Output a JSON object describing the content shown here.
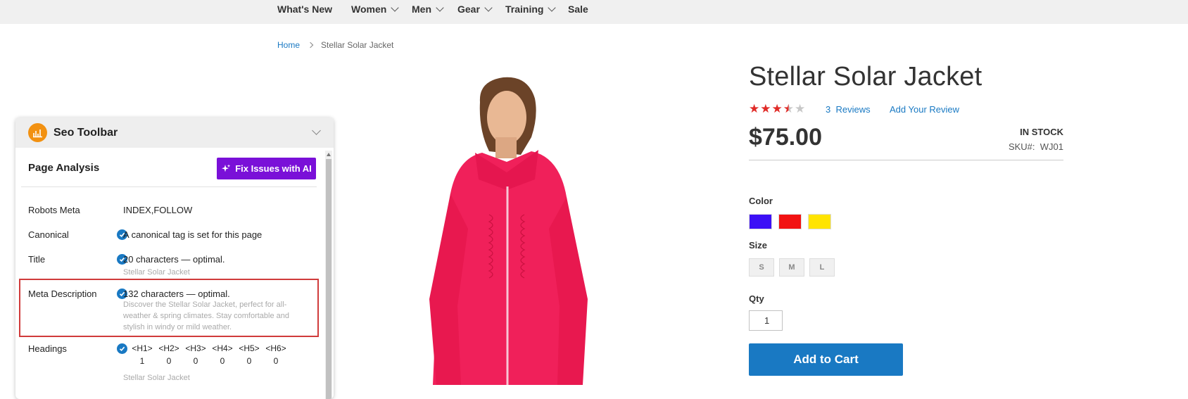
{
  "nav": {
    "items": [
      {
        "label": "What's New",
        "dropdown": false
      },
      {
        "label": "Women",
        "dropdown": true
      },
      {
        "label": "Men",
        "dropdown": true
      },
      {
        "label": "Gear",
        "dropdown": true
      },
      {
        "label": "Training",
        "dropdown": true
      },
      {
        "label": "Sale",
        "dropdown": false
      }
    ]
  },
  "breadcrumb": {
    "home": "Home",
    "current": "Stellar Solar Jacket"
  },
  "product": {
    "title": "Stellar Solar Jacket",
    "rating_stars": 3.5,
    "reviews_count": "3",
    "reviews_label": "Reviews",
    "add_review": "Add Your Review",
    "price": "$75.00",
    "stock": "IN STOCK",
    "sku_label": "SKU#:",
    "sku": "WJ01",
    "color_label": "Color",
    "colors": [
      "#3c10f6",
      "#f21212",
      "#ffe401"
    ],
    "size_label": "Size",
    "sizes": [
      "S",
      "M",
      "L"
    ],
    "qty_label": "Qty",
    "qty": "1",
    "cart_button": "Add to Cart"
  },
  "seo": {
    "title": "Seo Toolbar",
    "section_title": "Page Analysis",
    "fix_button": "Fix Issues with AI",
    "rows": {
      "robots": {
        "label": "Robots Meta",
        "value": "INDEX,FOLLOW"
      },
      "canonical": {
        "label": "Canonical",
        "value": "A canonical tag is set for this page"
      },
      "title": {
        "label": "Title",
        "value": "20 characters — optimal.",
        "sub": "Stellar Solar Jacket"
      },
      "meta": {
        "label": "Meta Description",
        "value": "132 characters — optimal.",
        "sub": "Discover the Stellar Solar Jacket, perfect for all-weather & spring climates. Stay comfortable and stylish in windy or mild weather."
      },
      "headings": {
        "label": "Headings",
        "sub": "Stellar Solar Jacket"
      }
    },
    "headings": [
      {
        "tag": "<H1>",
        "count": "1"
      },
      {
        "tag": "<H2>",
        "count": "0"
      },
      {
        "tag": "<H3>",
        "count": "0"
      },
      {
        "tag": "<H4>",
        "count": "0"
      },
      {
        "tag": "<H5>",
        "count": "0"
      },
      {
        "tag": "<H6>",
        "count": "0"
      }
    ]
  }
}
